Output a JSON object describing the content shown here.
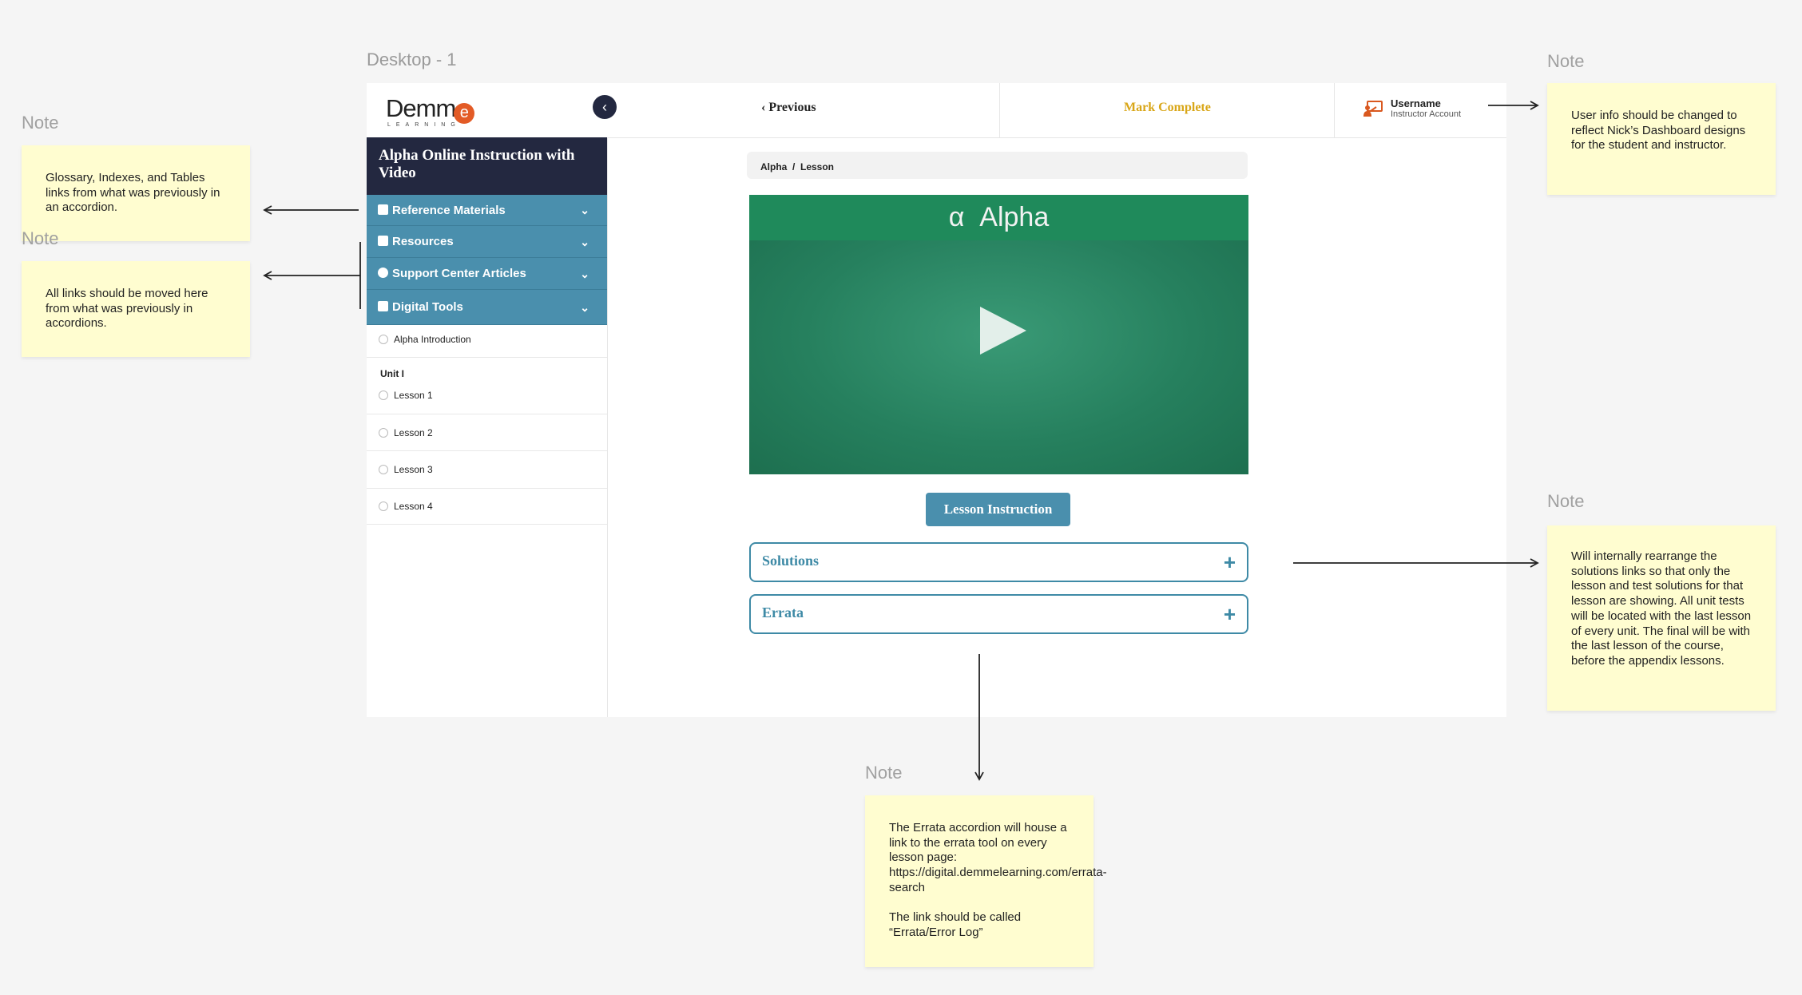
{
  "frame": {
    "label": "Desktop - 1"
  },
  "header": {
    "logo_text": "Demm",
    "logo_badge": "e",
    "logo_subtext": "LEARNING",
    "previous_label": "Previous",
    "mark_complete_label": "Mark Complete",
    "user_name": "Username",
    "user_role": "Instructor Account"
  },
  "sidebar": {
    "course_title": "Alpha Online Instruction with Video",
    "accordions": [
      {
        "label": "Reference Materials"
      },
      {
        "label": "Resources"
      },
      {
        "label": "Support Center Articles"
      },
      {
        "label": "Digital Tools"
      }
    ],
    "intro": "Alpha Introduction",
    "unit_label": "Unit I",
    "lessons": [
      "Lesson 1",
      "Lesson 2",
      "Lesson 3",
      "Lesson 4"
    ]
  },
  "main": {
    "breadcrumb": "Alpha  /  Lesson",
    "video_title": "α  Alpha",
    "lesson_button": "Lesson Instruction",
    "panels": [
      {
        "label": "Solutions",
        "icon": "+"
      },
      {
        "label": "Errata",
        "icon": "+"
      }
    ]
  },
  "notes": [
    {
      "label": "Note",
      "text": "Glossary, Indexes, and Tables links from what was previously in an accordion."
    },
    {
      "label": "Note",
      "text": "All links should be moved here from what was previously in accordions."
    },
    {
      "label": "Note",
      "text": "User info should be changed to reflect Nick’s Dashboard designs for the student and instructor."
    },
    {
      "label": "Note",
      "text": "Will internally rearrange the solutions links so that only the lesson and test solutions for that lesson are showing. All unit tests will be located with the last lesson of every unit. The final will be with the last lesson of the course, before the appendix lessons."
    },
    {
      "label": "Note",
      "text": "The Errata accordion will house a link to the errata tool on every lesson page: https://digital.demmelearning.com/errata-search\n\nThe link should be called “Errata/Error Log”"
    }
  ],
  "colors": {
    "nav_dark": "#232840",
    "accent_blue": "#4a8fad",
    "mark_complete": "#d9a617",
    "video_green": "#1f8a5b",
    "sticky": "#fffdd0"
  }
}
